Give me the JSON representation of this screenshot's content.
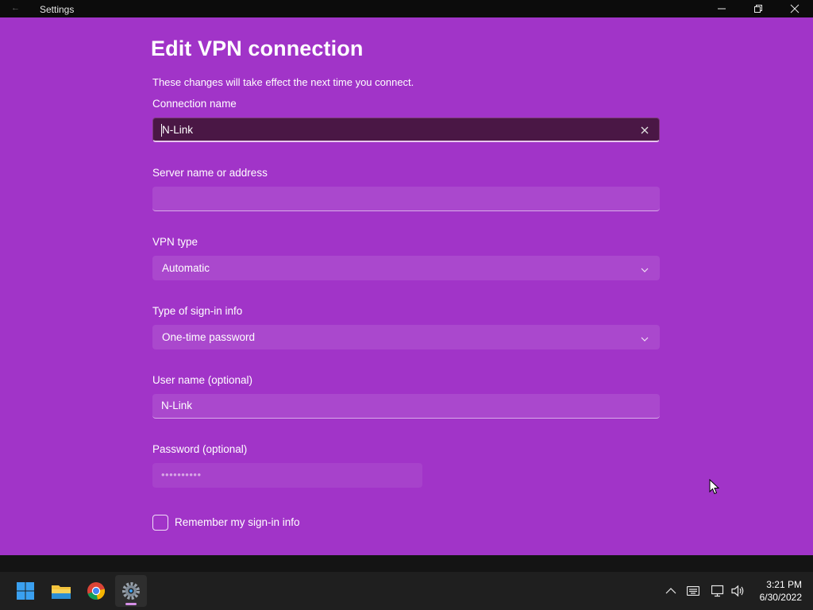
{
  "window": {
    "title": "Settings",
    "back_icon": "back-arrow-icon",
    "controls": [
      "minimize-icon",
      "maximize-icon",
      "close-icon"
    ]
  },
  "dialog": {
    "title": "Edit VPN connection",
    "description": "These changes will take effect the next time you connect."
  },
  "form": {
    "connection_name": {
      "label": "Connection name",
      "value": "N-Link"
    },
    "server": {
      "label": "Server name or address",
      "value": ""
    },
    "vpn_type": {
      "label": "VPN type",
      "value": "Automatic"
    },
    "signin_type": {
      "label": "Type of sign-in info",
      "value": "One-time password"
    },
    "username": {
      "label": "User name (optional)",
      "value": "N-Link"
    },
    "password": {
      "label": "Password (optional)",
      "value": "••••••••••"
    },
    "remember": {
      "label": "Remember my sign-in info",
      "checked": false
    }
  },
  "taskbar": {
    "apps": [
      "windows-start-icon",
      "file-explorer-icon",
      "chrome-icon",
      "settings-icon"
    ],
    "tray": [
      "chevron-up-icon",
      "keyboard-icon",
      "network-icon",
      "volume-icon"
    ],
    "time": "3:21 PM",
    "date": "6/30/2022"
  },
  "colors": {
    "panel": "#a134c8",
    "active_input": "#4a1745",
    "accent_indicator": "#d58fe6"
  }
}
